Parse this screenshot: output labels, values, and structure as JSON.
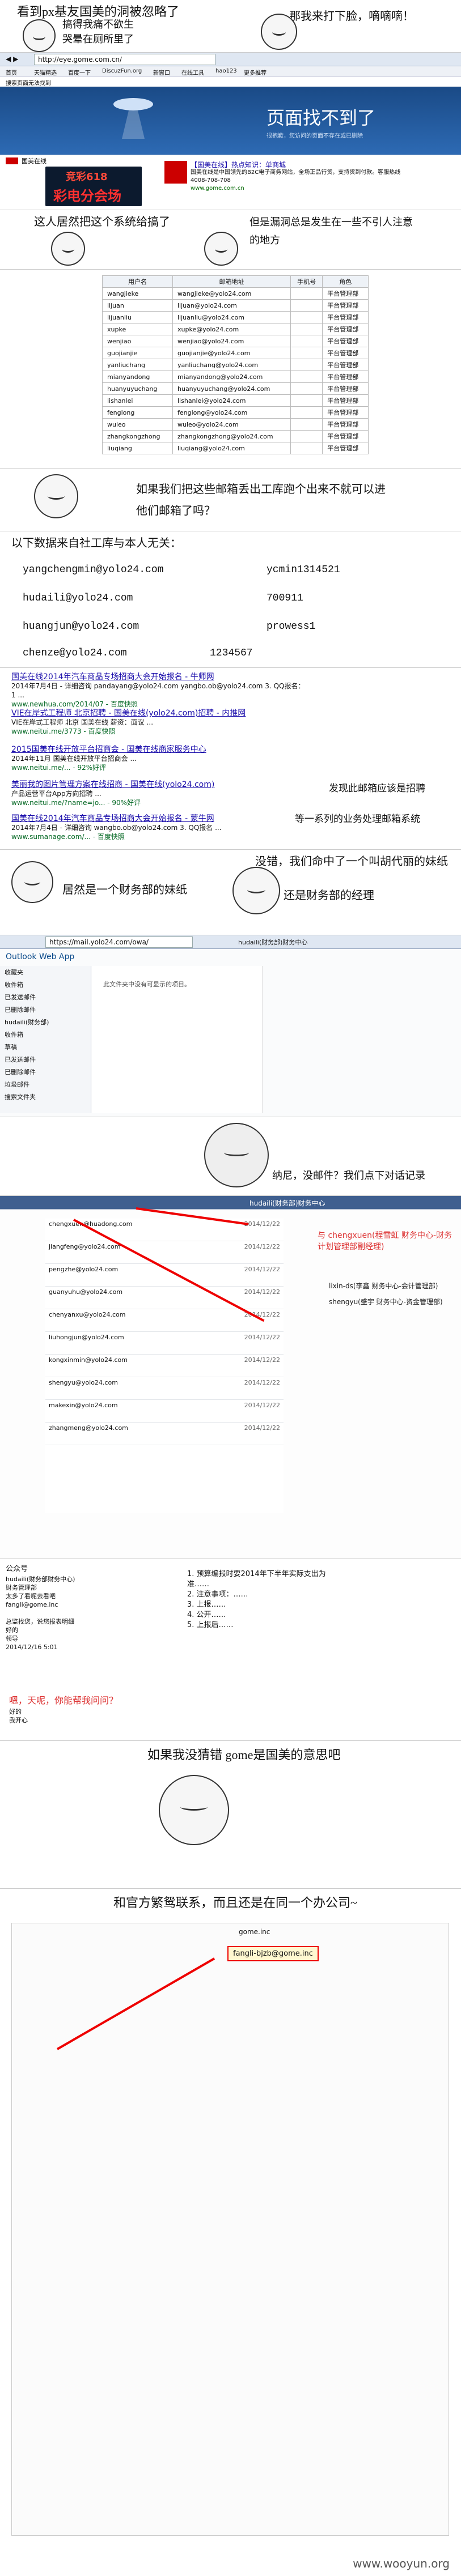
{
  "panel1": {
    "caption_left": "看到px基友国美的洞被忽略了",
    "caption_mid1": "搞得我痛不欲生",
    "caption_mid2": "哭晕在厕所里了",
    "caption_right": "那我来打下脸，嘀嘀嘀！"
  },
  "browser": {
    "url": "http://eye.gome.com.cn/",
    "tabs": [
      "首页",
      "天猫精选",
      "百度一下",
      "DiscuzFun.org",
      "新窗口",
      "在线工具",
      "hao123",
      "更多推荐"
    ],
    "page_tab": "搜索页面无法找到",
    "banner_title": "页面找不到了",
    "banner_sub": "很抱歉，您访问的页面不存在或已删除",
    "logo_text": "国美在线",
    "ad_text": "彩电分会场",
    "ad_sub": "竞彩618",
    "notice_title": "【国美在线】热点知识：单商城",
    "notice_body": "国美在线是中国领先的B2C电子商务网站，全场正品行货，支持货到付款。客服热线4008-708-708",
    "site": "www.gome.com.cn"
  },
  "panel3": {
    "caption_left": "这人居然把这个系统给搞了",
    "caption_right1": "但是漏洞总是发生在一些不引人注意",
    "caption_right2": "的地方"
  },
  "user_table": {
    "headers": [
      "用户名",
      "邮箱地址",
      "手机号",
      "角色"
    ],
    "rows": [
      [
        "wangjieke",
        "wangjieke@yolo24.com",
        "",
        "平台管理部"
      ],
      [
        "lijuan",
        "lijuan@yolo24.com",
        "",
        "平台管理部"
      ],
      [
        "lijuanliu",
        "lijuanliu@yolo24.com",
        "",
        "平台管理部"
      ],
      [
        "xupke",
        "xupke@yolo24.com",
        "",
        "平台管理部"
      ],
      [
        "wenjiao",
        "wenjiao@yolo24.com",
        "",
        "平台管理部"
      ],
      [
        "guojianjie",
        "guojianjie@yolo24.com",
        "",
        "平台管理部"
      ],
      [
        "yanliuchang",
        "yanliuchang@yolo24.com",
        "",
        "平台管理部"
      ],
      [
        "mianyandong",
        "mianyandong@yolo24.com",
        "",
        "平台管理部"
      ],
      [
        "huanyuyuchang",
        "huanyuyuchang@yolo24.com",
        "",
        "平台管理部"
      ],
      [
        "lishanlei",
        "lishanlei@yolo24.com",
        "",
        "平台管理部"
      ],
      [
        "fenglong",
        "fenglong@yolo24.com",
        "",
        "平台管理部"
      ],
      [
        "wuleo",
        "wuleo@yolo24.com",
        "",
        "平台管理部"
      ],
      [
        "zhangkongzhong",
        "zhangkongzhong@yolo24.com",
        "",
        "平台管理部"
      ],
      [
        "liuqiang",
        "liuqiang@yolo24.com",
        "",
        "平台管理部"
      ]
    ]
  },
  "panel5": {
    "caption1": "如果我们把这些邮箱丢出工库跑个出来不就可以进",
    "caption2": "他们邮箱了吗？",
    "intro": "以下数据来自社工库与本人无关：",
    "creds": [
      {
        "email": "yangchengmin@yolo24.com",
        "password": "ycmin1314521"
      },
      {
        "email": "hudaili@yolo24.com",
        "password": "700911"
      },
      {
        "email": "huangjun@yolo24.com",
        "password": "prowess1"
      },
      {
        "email": "chenze@yolo24.com",
        "password": "1234567"
      }
    ]
  },
  "search": {
    "results": [
      {
        "title": "国美在线2014年汽车商品专场招商大会开始报名 - 牛师网",
        "body": "2014年7月4日 - 详细咨询 pandayang@yolo24.com yangbo.ob@yolo24.com 3. QQ报名：1 ...",
        "url": "www.newhua.com/2014/07 - 百度快照"
      },
      {
        "title": "VIE在岸式工程师 北京招聘 - 国美在线(yolo24.com)招聘 - 内推网",
        "body": "VIE在岸式工程师 北京 国美在线 薪资：面议 ...",
        "url": "www.neitui.me/3773 - 百度快照"
      },
      {
        "title": "2015国美在线开放平台招商会 - 国美在线商家服务中心",
        "body": "2014年11月 国美在线开放平台招商会 ...",
        "url": "www.neitui.me/... - 92%好评"
      },
      {
        "title": "美丽我的图片管理方案在线招商 - 国美在线(yolo24.com)",
        "body": "产品运营平台App方向招聘 ...",
        "url": "www.neitui.me/?name=jo... - 90%好评"
      },
      {
        "title": "国美在线2014年汽车商品专场招商大会开始报名 - 蒙牛网",
        "body": "2014年7月4日 - 详细咨询 wangbo.ob@yolo24.com 3. QQ报名 ...",
        "url": "www.sumanage.com/... - 百度快照"
      }
    ],
    "note1": "发现此邮箱应该是招聘",
    "note2": "等一系列的业务处理邮箱系统"
  },
  "panel7": {
    "left": "居然是一个财务部的妹纸",
    "right1": "没错，我们命中了一个叫胡代丽的妹纸",
    "right2": "还是财务部的经理"
  },
  "owa": {
    "url": "https://mail.yolo24.com/owa/",
    "tab": "hudaili(财务部)财务中心",
    "title": "Outlook Web App",
    "folders": [
      "收藏夹",
      "收件箱",
      "已发送邮件",
      "已删除邮件",
      "hudaili(财务部)",
      "收件箱",
      "草稿",
      "已发送邮件",
      "已删除邮件",
      "垃圾邮件",
      "搜索文件夹"
    ],
    "empty": "此文件夹中没有可显示的项目。"
  },
  "panel9": {
    "caption": "纳尼，没邮件？我们点下对话记录"
  },
  "chatlist": {
    "app": "hudaili(财务部)财务中心",
    "items": [
      {
        "name": "chengxuen@huadong.com",
        "date": "2014/12/22"
      },
      {
        "name": "jiangfeng@yolo24.com",
        "date": "2014/12/22"
      },
      {
        "name": "pengzhe@yolo24.com",
        "date": "2014/12/22"
      },
      {
        "name": "guanyuhu@yolo24.com",
        "date": "2014/12/22"
      },
      {
        "name": "chenyanxu@yolo24.com",
        "date": "2014/12/22"
      },
      {
        "name": "liuhongjun@yolo24.com",
        "date": "2014/12/22"
      },
      {
        "name": "kongxinmin@yolo24.com",
        "date": "2014/12/22"
      },
      {
        "name": "shengyu@yolo24.com",
        "date": "2014/12/22"
      },
      {
        "name": "makexin@yolo24.com",
        "date": "2014/12/22"
      },
      {
        "name": "zhangmeng@yolo24.com",
        "date": "2014/12/22"
      }
    ],
    "highlight1": "与 chengxuen(程雪虹 财务中心-财务计划管理部副经理)",
    "highlight2": "lixin-ds(李鑫 财务中心-会计管理部)",
    "highlight3": "shengyu(盛宇 财务中心-资金管理部)"
  },
  "chatdetail": {
    "top": "公众号",
    "lines": "hudaili(财务部财务中心)\n财务管理部\n太多了看呢去看吧\nfangli@gome.inc\n\n总监找您，说您报表明细\n好的\n领导\n2014/12/16 5:01",
    "nums": "1. 预算编报时要2014年下半年实际支出为准……\n2. 注意事项：……\n3. 上报……\n4. 公开……\n5. 上报后……",
    "warn": "嗯，天呢，你能帮我问问？",
    "extra": "好的\n我开心"
  },
  "panel13": {
    "caption": "如果我没猜错 gome是国美的意思吧"
  },
  "panel14": {
    "caption": "和官方繁鸳联系，而且还是在同一个办公司~",
    "mail": "gome.inc",
    "highlight": "fangli-bjzb@gome.inc",
    "footer": "www.wooyun.org"
  }
}
